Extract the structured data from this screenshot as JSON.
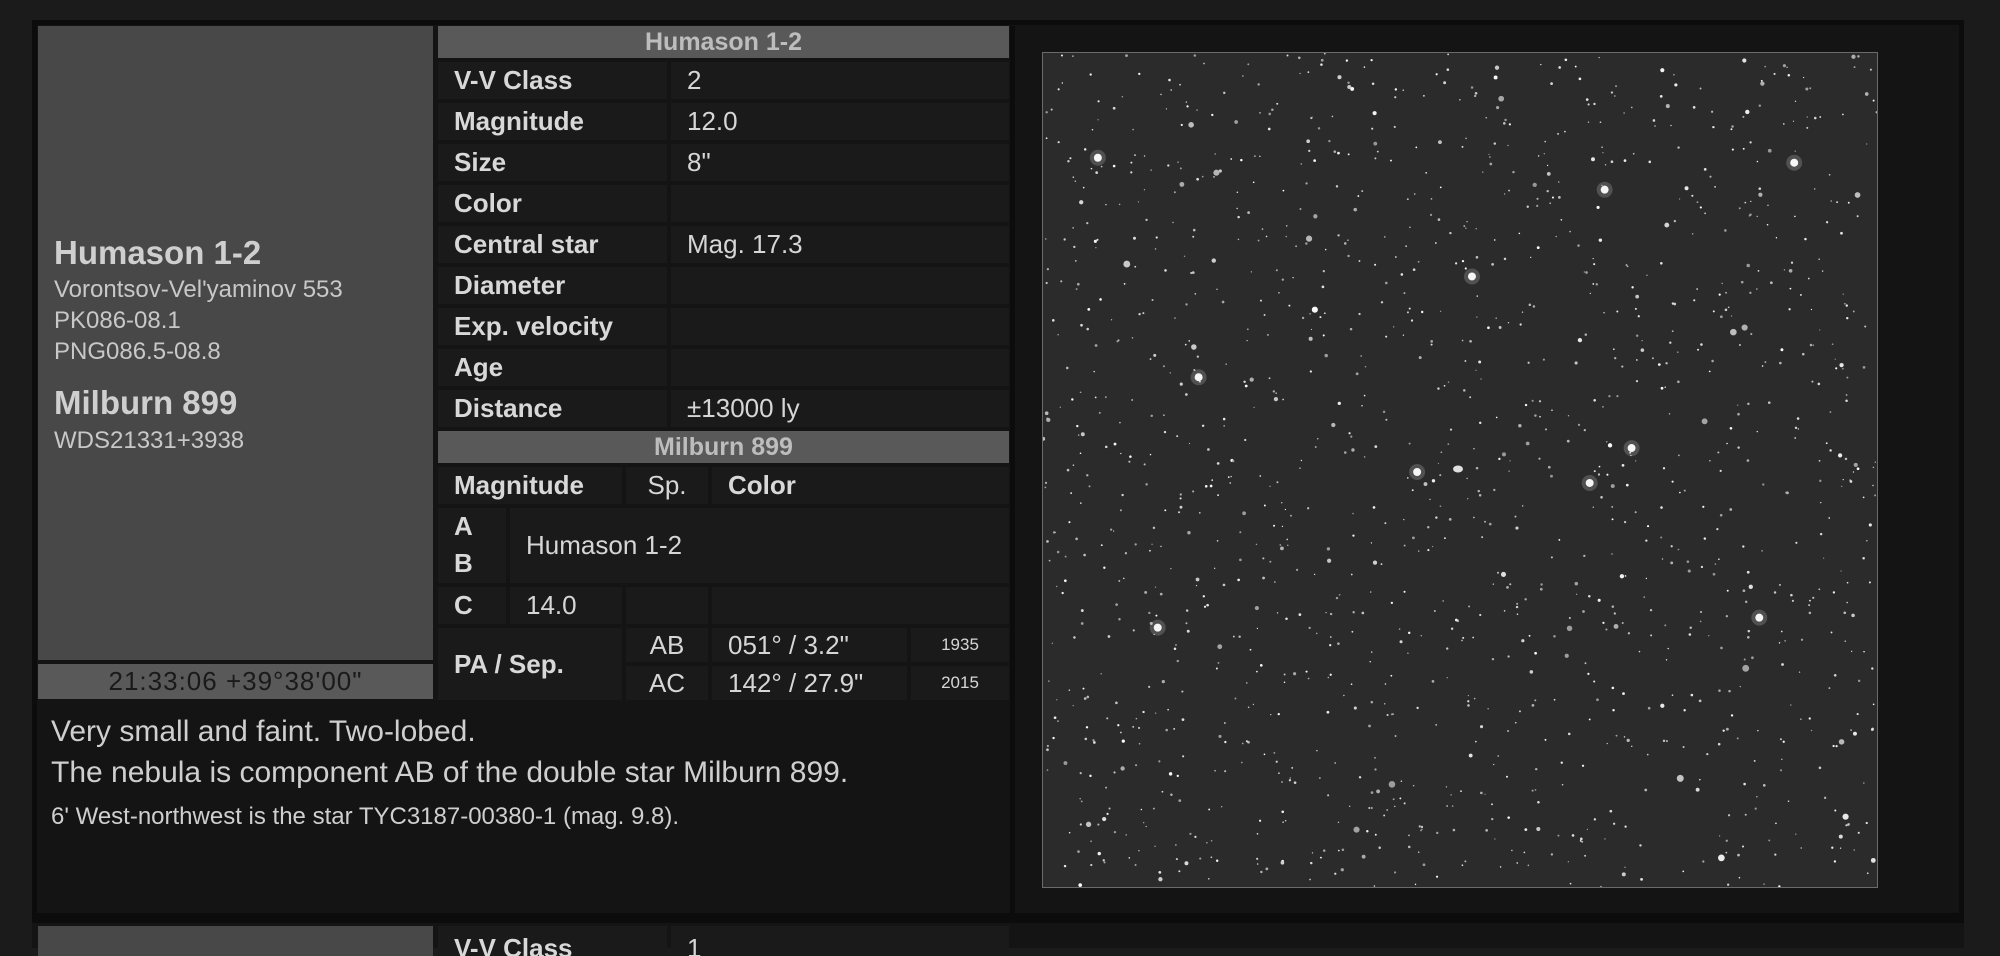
{
  "identity": {
    "primary_name": "Humason 1-2",
    "aliases": [
      "Vorontsov-Vel'yaminov 553",
      "PK086-08.1",
      "PNG086.5-08.8"
    ],
    "secondary_name": "Milburn 899",
    "secondary_alias": "WDS21331+3938",
    "coordinates": "21:33:06 +39°38'00\""
  },
  "nebula_table": {
    "header": "Humason 1-2",
    "rows": [
      {
        "label": "V-V Class",
        "value": "2"
      },
      {
        "label": "Magnitude",
        "value": "12.0"
      },
      {
        "label": "Size",
        "value": "8\""
      },
      {
        "label": "Color",
        "value": ""
      },
      {
        "label": "Central star",
        "value": "Mag. 17.3"
      },
      {
        "label": "Diameter",
        "value": ""
      },
      {
        "label": "Exp. velocity",
        "value": ""
      },
      {
        "label": "Age",
        "value": ""
      },
      {
        "label": "Distance",
        "value": "±13000 ly"
      }
    ]
  },
  "double_table": {
    "header": "Milburn 899",
    "columns": [
      "Magnitude",
      "Sp.",
      "Color"
    ],
    "components": [
      "A",
      "B",
      "C"
    ],
    "ab_value": "Humason 1-2",
    "c_magnitude": "14.0",
    "pa_label": "PA / Sep.",
    "pa_rows": [
      {
        "pair": "AB",
        "value": "051° / 3.2\"",
        "year": "1935"
      },
      {
        "pair": "AC",
        "value": "142° / 27.9\"",
        "year": "2015"
      }
    ]
  },
  "notes": [
    "Very small and faint. Two-lobed.",
    "The nebula is component AB of the double star Milburn 899.",
    "6' West-northwest is the star TYC3187-00380-1 (mag. 9.8)."
  ],
  "next_card": {
    "first_label": "V-V Class",
    "first_value": "1"
  }
}
